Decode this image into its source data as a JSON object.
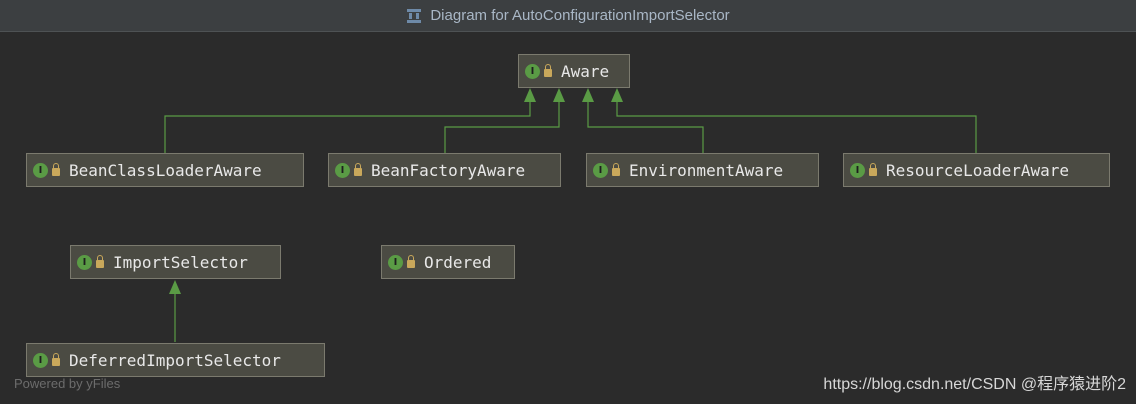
{
  "window": {
    "title": "Diagram for AutoConfigurationImportSelector"
  },
  "nodes": {
    "aware": "Aware",
    "bean_class_loader_aware": "BeanClassLoaderAware",
    "bean_factory_aware": "BeanFactoryAware",
    "environment_aware": "EnvironmentAware",
    "resource_loader_aware": "ResourceLoaderAware",
    "import_selector": "ImportSelector",
    "ordered": "Ordered",
    "deferred_import_selector": "DeferredImportSelector"
  },
  "node_kind_badge": "I",
  "edge_color": "#5a9b45",
  "footer": {
    "powered_by": "Powered by yFiles",
    "watermark": "https://blog.csdn.net/CSDN @程序猿进阶2"
  }
}
